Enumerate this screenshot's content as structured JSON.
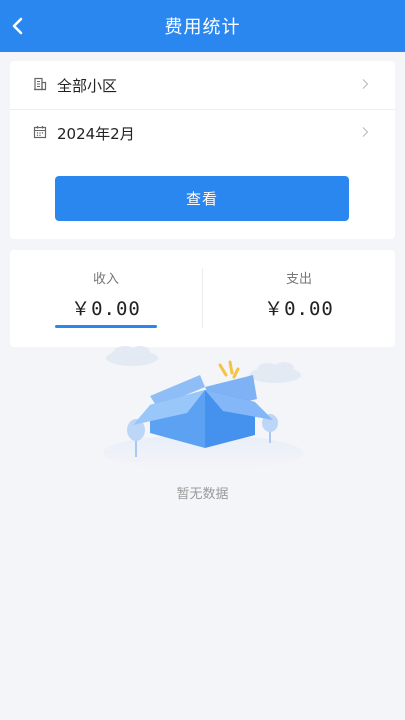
{
  "header": {
    "title": "费用统计",
    "back_icon": "chevron-left-icon"
  },
  "filters": {
    "community": {
      "label": "全部小区",
      "icon": "building-icon"
    },
    "month": {
      "label": "2024年2月",
      "icon": "calendar-icon"
    },
    "view_button_label": "查看"
  },
  "summary": {
    "income": {
      "label": "收入",
      "amount": "￥0.00",
      "selected": true
    },
    "expense": {
      "label": "支出",
      "amount": "￥0.00",
      "selected": false
    }
  },
  "empty_state": {
    "text": "暂无数据",
    "illustration": "empty-box-illustration"
  },
  "colors": {
    "accent": "#2b87f0",
    "background": "#f4f5f9"
  }
}
